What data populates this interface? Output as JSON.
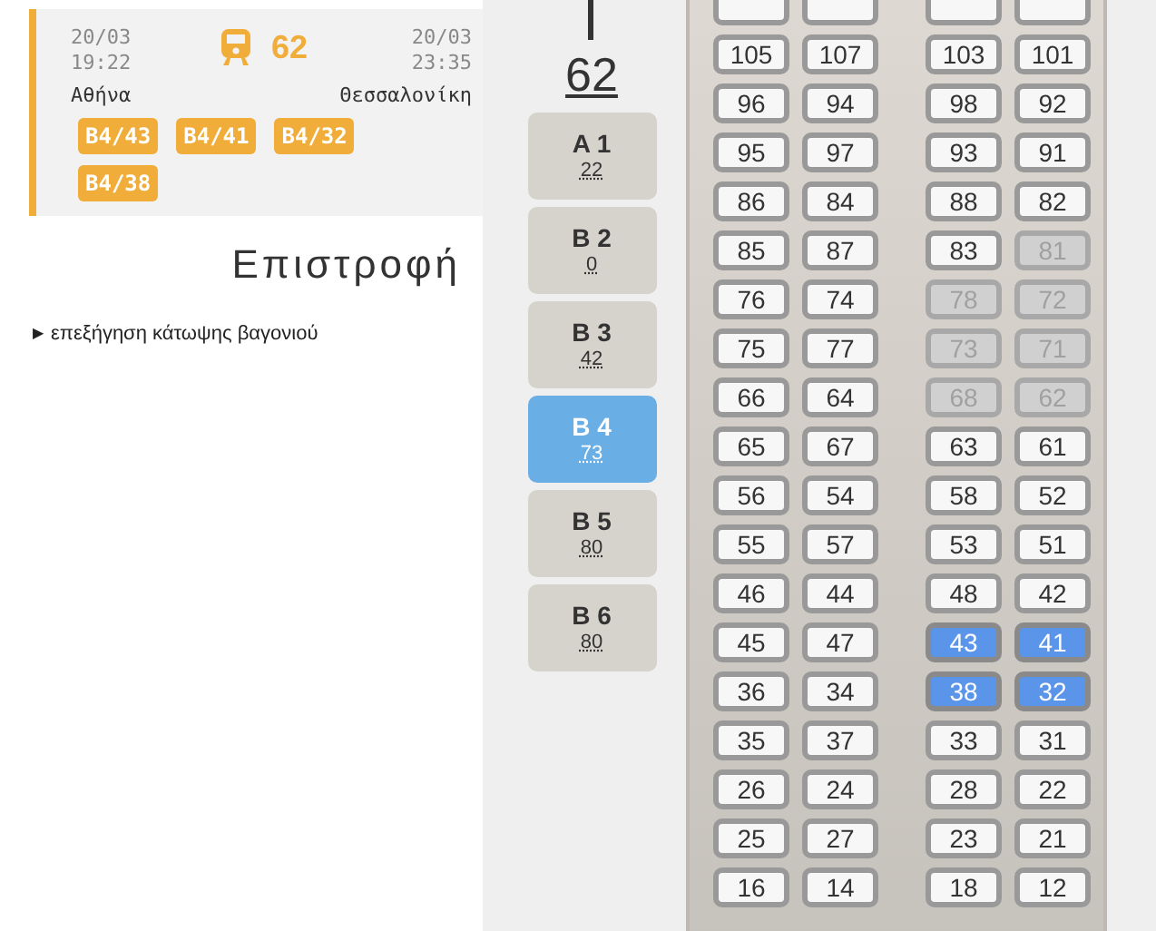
{
  "trip": {
    "departure_date": "20/03",
    "departure_time": "19:22",
    "train_number": "62",
    "arrival_date": "20/03",
    "arrival_time": "23:35",
    "from": "Αθήνα",
    "to": "Θεσσαλονίκη",
    "tickets": [
      "B4/43",
      "B4/41",
      "B4/32",
      "B4/38"
    ]
  },
  "return_heading": "Επιστροφή",
  "explanation": {
    "marker": "▶",
    "label": "επεξήγηση κάτωψης βαγονιού"
  },
  "train": {
    "number": "62",
    "coaches": [
      {
        "label": "A 1",
        "free": "22",
        "selected": false
      },
      {
        "label": "B 2",
        "free": "0",
        "selected": false
      },
      {
        "label": "B 3",
        "free": "42",
        "selected": false
      },
      {
        "label": "B 4",
        "free": "73",
        "selected": true
      },
      {
        "label": "B 5",
        "free": "80",
        "selected": false
      },
      {
        "label": "B 6",
        "free": "80",
        "selected": false
      }
    ]
  },
  "seat_rows": [
    [
      {
        "taken": false,
        "selected": false
      },
      {
        "taken": false,
        "selected": false
      },
      {
        "taken": false,
        "selected": false
      },
      {
        "taken": false,
        "selected": false
      }
    ],
    [
      {
        "n": "105",
        "taken": false,
        "selected": false
      },
      {
        "n": "107",
        "taken": false,
        "selected": false
      },
      {
        "n": "103",
        "taken": false,
        "selected": false
      },
      {
        "n": "101",
        "taken": false,
        "selected": false
      }
    ],
    [
      {
        "n": "96",
        "taken": false,
        "selected": false
      },
      {
        "n": "94",
        "taken": false,
        "selected": false
      },
      {
        "n": "98",
        "taken": false,
        "selected": false
      },
      {
        "n": "92",
        "taken": false,
        "selected": false
      }
    ],
    [
      {
        "n": "95",
        "taken": false,
        "selected": false
      },
      {
        "n": "97",
        "taken": false,
        "selected": false
      },
      {
        "n": "93",
        "taken": false,
        "selected": false
      },
      {
        "n": "91",
        "taken": false,
        "selected": false
      }
    ],
    [
      {
        "n": "86",
        "taken": false,
        "selected": false
      },
      {
        "n": "84",
        "taken": false,
        "selected": false
      },
      {
        "n": "88",
        "taken": false,
        "selected": false
      },
      {
        "n": "82",
        "taken": false,
        "selected": false
      }
    ],
    [
      {
        "n": "85",
        "taken": false,
        "selected": false
      },
      {
        "n": "87",
        "taken": false,
        "selected": false
      },
      {
        "n": "83",
        "taken": false,
        "selected": false
      },
      {
        "n": "81",
        "taken": true,
        "selected": false
      }
    ],
    [
      {
        "n": "76",
        "taken": false,
        "selected": false
      },
      {
        "n": "74",
        "taken": false,
        "selected": false
      },
      {
        "n": "78",
        "taken": true,
        "selected": false
      },
      {
        "n": "72",
        "taken": true,
        "selected": false
      }
    ],
    [
      {
        "n": "75",
        "taken": false,
        "selected": false
      },
      {
        "n": "77",
        "taken": false,
        "selected": false
      },
      {
        "n": "73",
        "taken": true,
        "selected": false
      },
      {
        "n": "71",
        "taken": true,
        "selected": false
      }
    ],
    [
      {
        "n": "66",
        "taken": false,
        "selected": false
      },
      {
        "n": "64",
        "taken": false,
        "selected": false
      },
      {
        "n": "68",
        "taken": true,
        "selected": false
      },
      {
        "n": "62",
        "taken": true,
        "selected": false
      }
    ],
    [
      {
        "n": "65",
        "taken": false,
        "selected": false
      },
      {
        "n": "67",
        "taken": false,
        "selected": false
      },
      {
        "n": "63",
        "taken": false,
        "selected": false
      },
      {
        "n": "61",
        "taken": false,
        "selected": false
      }
    ],
    [
      {
        "n": "56",
        "taken": false,
        "selected": false
      },
      {
        "n": "54",
        "taken": false,
        "selected": false
      },
      {
        "n": "58",
        "taken": false,
        "selected": false
      },
      {
        "n": "52",
        "taken": false,
        "selected": false
      }
    ],
    [
      {
        "n": "55",
        "taken": false,
        "selected": false
      },
      {
        "n": "57",
        "taken": false,
        "selected": false
      },
      {
        "n": "53",
        "taken": false,
        "selected": false
      },
      {
        "n": "51",
        "taken": false,
        "selected": false
      }
    ],
    [
      {
        "n": "46",
        "taken": false,
        "selected": false
      },
      {
        "n": "44",
        "taken": false,
        "selected": false
      },
      {
        "n": "48",
        "taken": false,
        "selected": false
      },
      {
        "n": "42",
        "taken": false,
        "selected": false
      }
    ],
    [
      {
        "n": "45",
        "taken": false,
        "selected": false
      },
      {
        "n": "47",
        "taken": false,
        "selected": false
      },
      {
        "n": "43",
        "taken": false,
        "selected": true
      },
      {
        "n": "41",
        "taken": false,
        "selected": true
      }
    ],
    [
      {
        "n": "36",
        "taken": false,
        "selected": false
      },
      {
        "n": "34",
        "taken": false,
        "selected": false
      },
      {
        "n": "38",
        "taken": false,
        "selected": true
      },
      {
        "n": "32",
        "taken": false,
        "selected": true
      }
    ],
    [
      {
        "n": "35",
        "taken": false,
        "selected": false
      },
      {
        "n": "37",
        "taken": false,
        "selected": false
      },
      {
        "n": "33",
        "taken": false,
        "selected": false
      },
      {
        "n": "31",
        "taken": false,
        "selected": false
      }
    ],
    [
      {
        "n": "26",
        "taken": false,
        "selected": false
      },
      {
        "n": "24",
        "taken": false,
        "selected": false
      },
      {
        "n": "28",
        "taken": false,
        "selected": false
      },
      {
        "n": "22",
        "taken": false,
        "selected": false
      }
    ],
    [
      {
        "n": "25",
        "taken": false,
        "selected": false
      },
      {
        "n": "27",
        "taken": false,
        "selected": false
      },
      {
        "n": "23",
        "taken": false,
        "selected": false
      },
      {
        "n": "21",
        "taken": false,
        "selected": false
      }
    ],
    [
      {
        "n": "16",
        "taken": false,
        "selected": false
      },
      {
        "n": "14",
        "taken": false,
        "selected": false
      },
      {
        "n": "18",
        "taken": false,
        "selected": false
      },
      {
        "n": "12",
        "taken": false,
        "selected": false
      }
    ]
  ]
}
